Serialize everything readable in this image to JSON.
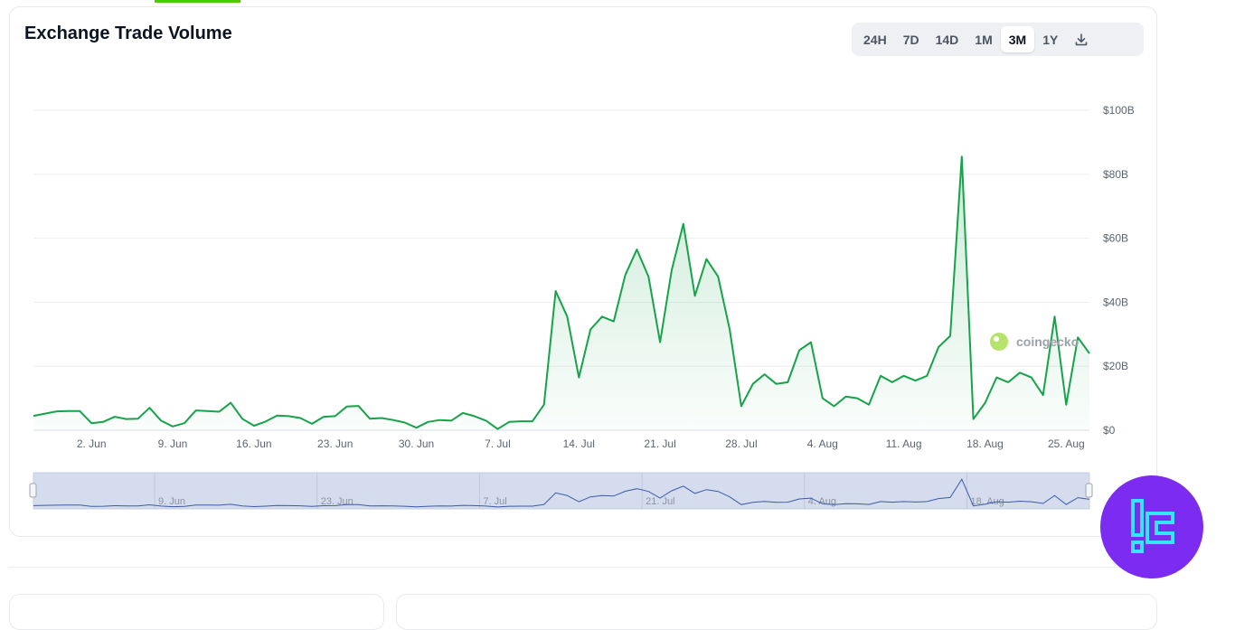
{
  "header": {
    "title": "Exchange Trade Volume"
  },
  "ranges": {
    "items": [
      "24H",
      "7D",
      "14D",
      "1M",
      "3M",
      "1Y"
    ],
    "active": "3M"
  },
  "watermark": {
    "text": "coingecko"
  },
  "colors": {
    "line": "#16a34a",
    "accent": "#4bcc00",
    "navigator_fill": "#d5dcee",
    "logo_bg": "#7b2cf0",
    "logo_fg": "#33e6ff"
  },
  "chart_data": {
    "type": "area",
    "title": "Exchange Trade Volume",
    "xlabel": "",
    "ylabel": "",
    "unit": "B (USD)",
    "y_tick_labels": [
      "$0",
      "$20B",
      "$40B",
      "$60B",
      "$80B",
      "$100B"
    ],
    "y_ticks": [
      0,
      20,
      40,
      60,
      80,
      100
    ],
    "ylim": [
      0,
      100
    ],
    "x_tick_labels": [
      "2. Jun",
      "9. Jun",
      "16. Jun",
      "23. Jun",
      "30. Jun",
      "7. Jul",
      "14. Jul",
      "21. Jul",
      "28. Jul",
      "4. Aug",
      "11. Aug",
      "18. Aug",
      "25. Aug"
    ],
    "x_tick_positions": [
      5,
      12,
      19,
      26,
      33,
      40,
      47,
      54,
      61,
      68,
      75,
      82,
      89
    ],
    "navigator_labels": [
      "9. Jun",
      "23. Jun",
      "7. Jul",
      "21. Jul",
      "4. Aug",
      "18. Aug"
    ],
    "navigator_label_positions": [
      12,
      26,
      40,
      54,
      68,
      82
    ],
    "x_range": [
      0,
      91
    ],
    "grid": true,
    "series": [
      {
        "values": [
          4.5,
          5.2,
          5.9,
          6.0,
          6.0,
          2.2,
          2.6,
          4.2,
          3.5,
          3.6,
          7.0,
          3.0,
          1.2,
          2.2,
          6.2,
          6.0,
          5.8,
          8.6,
          3.6,
          1.4,
          2.7,
          4.6,
          4.4,
          3.8,
          2.0,
          4.2,
          4.4,
          7.4,
          7.6,
          3.6,
          3.8,
          3.2,
          2.4,
          0.8,
          2.6,
          3.2,
          3.0,
          5.4,
          4.4,
          3.0,
          0.4,
          2.6,
          2.8,
          2.8,
          8.0,
          43.5,
          35.5,
          16.5,
          31.5,
          35.5,
          34.0,
          48.5,
          56.5,
          48.0,
          27.5,
          50.0,
          64.5,
          42.0,
          53.5,
          48.0,
          31.5,
          7.5,
          14.5,
          17.5,
          14.5,
          15.0,
          25.0,
          27.5,
          10.0,
          7.5,
          10.5,
          10.0,
          8.0,
          17.0,
          15.0,
          17.0,
          15.5,
          17.0,
          26.0,
          29.5,
          85.5,
          3.5,
          8.5,
          16.5,
          15.0,
          18.0,
          16.5,
          11.0,
          35.5,
          8.0,
          29.0,
          24.0
        ]
      }
    ]
  }
}
